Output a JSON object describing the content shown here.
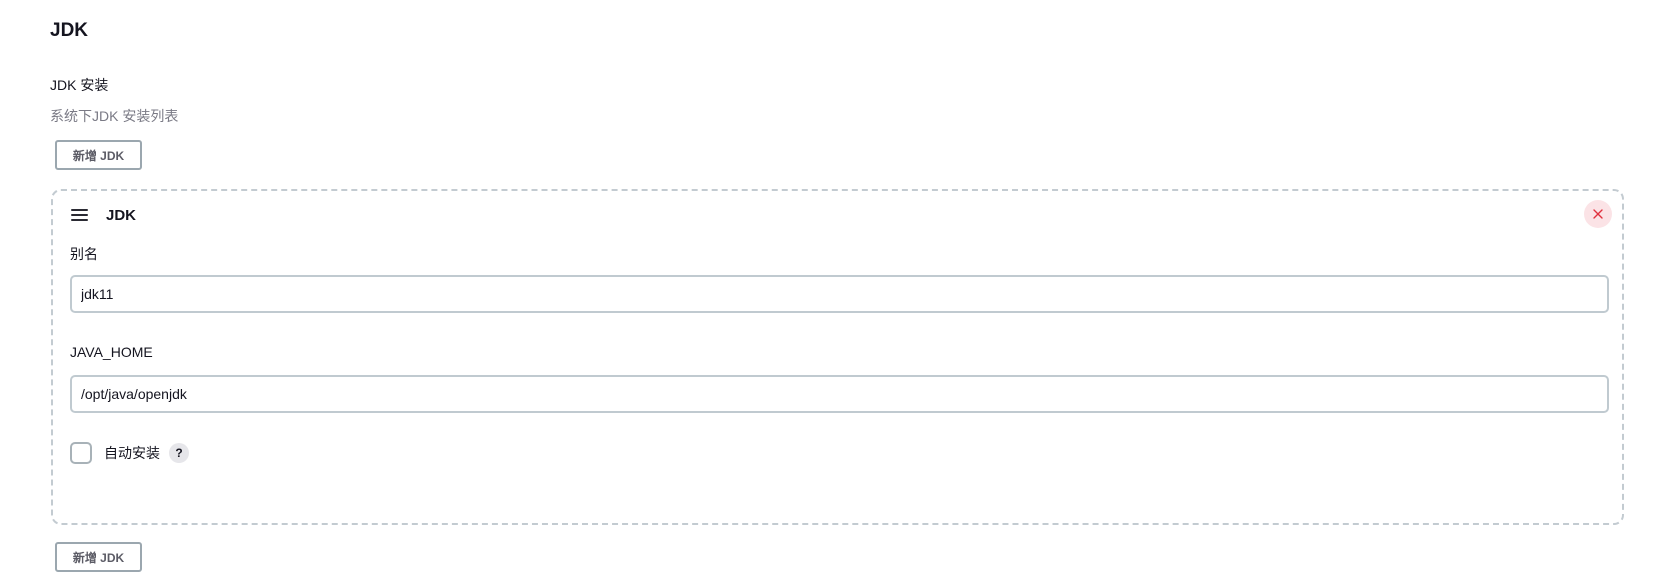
{
  "section": {
    "title": "JDK"
  },
  "installations": {
    "label": "JDK 安装",
    "description": "系统下JDK 安装列表",
    "add_button_label": "新增 JDK"
  },
  "jdk_entry": {
    "title": "JDK",
    "drag_icon": "hamburger-icon",
    "delete_icon": "close-icon",
    "alias_label": "别名",
    "alias_value": "jdk11",
    "java_home_label": "JAVA_HOME",
    "java_home_value": "/opt/java/openjdk",
    "auto_install_label": "自动安装",
    "auto_install_checked": false,
    "help_icon_text": "?"
  },
  "colors": {
    "delete_bg": "#fbe3e6",
    "delete_icon": "#e0303e",
    "border_dashed": "#c3cbd1",
    "muted_text": "#7a7a85"
  }
}
